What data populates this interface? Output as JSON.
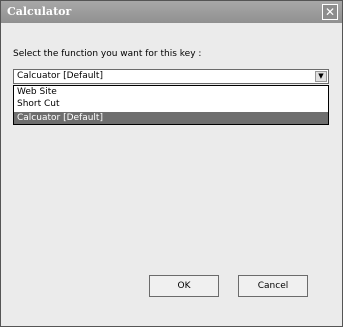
{
  "window": {
    "title": "Calculator",
    "close_glyph": "✕"
  },
  "dialog": {
    "prompt": "Select the function you want for this key :",
    "selected_value": "Calcuator [Default]",
    "dropdown_glyph": "▼",
    "options": [
      {
        "label": "Web Site"
      },
      {
        "label": "Short Cut"
      },
      {
        "label": "Calcuator [Default]"
      }
    ],
    "highlighted_option_index": 2
  },
  "buttons": {
    "ok": "OK",
    "cancel": "Cancel"
  },
  "colors": {
    "titlebar": "#9c9c9c",
    "highlight": "#6e6e6e",
    "window_bg": "#ebebeb"
  }
}
